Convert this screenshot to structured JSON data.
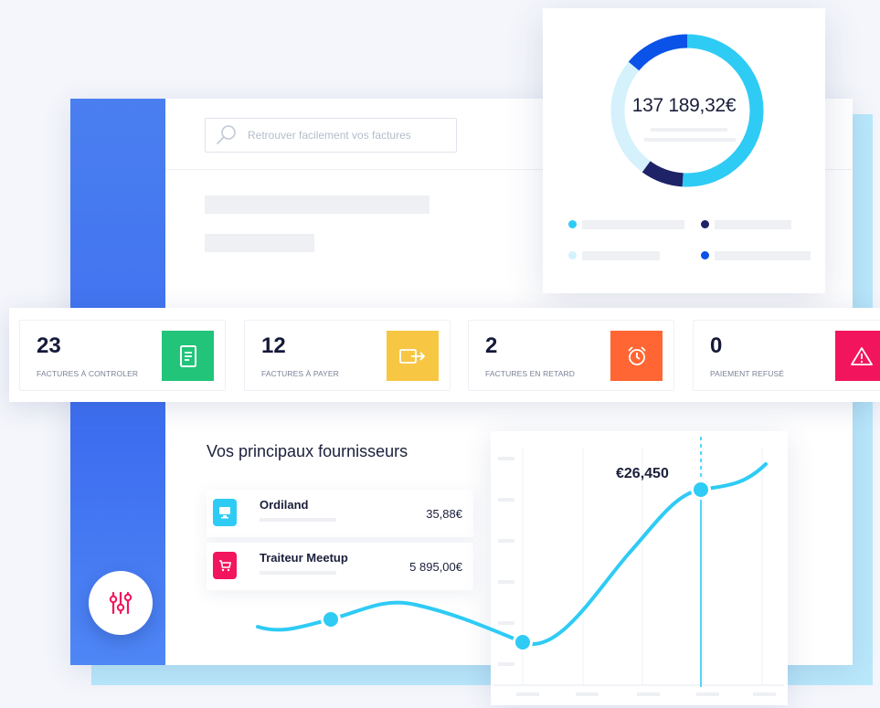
{
  "search": {
    "placeholder": "Retrouver facilement vos factures"
  },
  "summary_card": {
    "total": "137 189,32€",
    "segment_colors": {
      "cyan": "#2ecbf5",
      "pale": "#d4f1fc",
      "navy": "#1e2266",
      "blue": "#0b52e8"
    }
  },
  "kpis": [
    {
      "value": "23",
      "label": "FACTURES À CONTROLER",
      "icon": "document-icon",
      "color": "#22c47a"
    },
    {
      "value": "12",
      "label": "FACTURES À PAYER",
      "icon": "wallet-icon",
      "color": "#f7c744"
    },
    {
      "value": "2",
      "label": "FACTURES EN RETARD",
      "icon": "alarm-clock-icon",
      "color": "#ff6633"
    },
    {
      "value": "0",
      "label": "PAIEMENT REFUSÉ",
      "icon": "warning-icon",
      "color": "#f2155d"
    }
  ],
  "suppliers": {
    "title": "Vos principaux fournisseurs",
    "items": [
      {
        "name": "Ordiland",
        "amount": "35,88€",
        "icon": "computer-icon",
        "color": "#2ecbf5"
      },
      {
        "name": "Traiteur Meetup",
        "amount": "5 895,00€",
        "icon": "cart-icon",
        "color": "#f2155d"
      }
    ]
  },
  "chart": {
    "peak_label": "€26,450",
    "line_color": "#2ecbf5"
  },
  "colors": {
    "sidebar": "#4a7ff0",
    "frame": "#b9e8fb"
  }
}
